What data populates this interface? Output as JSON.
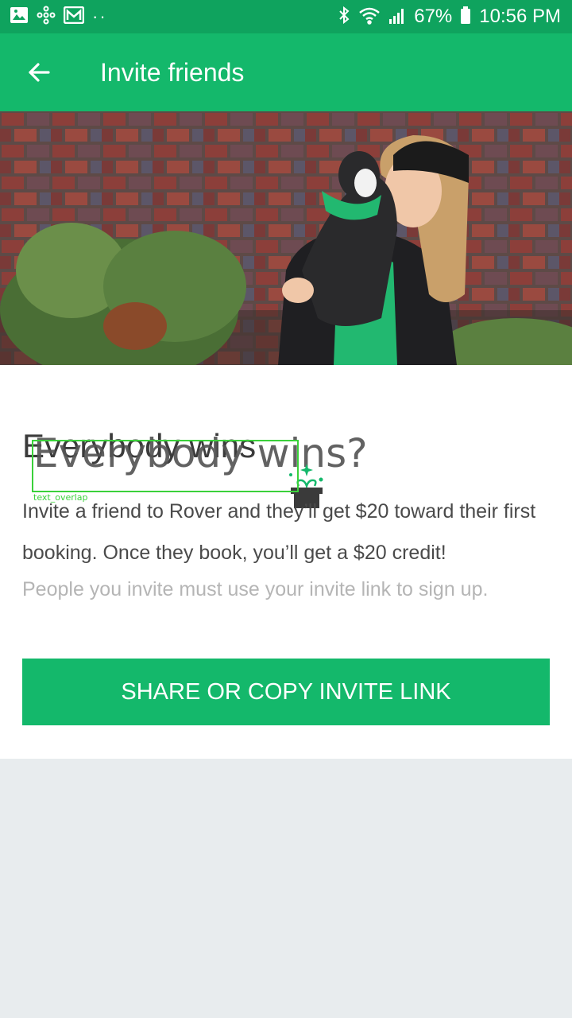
{
  "status_bar": {
    "battery": "67%",
    "time": "10:56 PM",
    "dots": "··",
    "icons": [
      "gallery-icon",
      "pinwheel-icon",
      "mail-icon",
      "bluetooth-icon",
      "wifi-icon",
      "signal-icon",
      "battery-icon"
    ]
  },
  "app_bar": {
    "title": "Invite friends",
    "back_icon": "arrow-left-icon"
  },
  "content": {
    "headline_back": "Everybody wins",
    "headline_front": "Everybody wins?",
    "gift_icon": "gift-icon",
    "overlap_label": "text_overlap",
    "body": "Invite a friend to Rover and they’ll get $20 toward their first booking. Once they book, you’ll get a $20 credit!",
    "note": "People you invite must use your invite link to sign up.",
    "cta_label": "SHARE OR COPY INVITE LINK"
  },
  "colors": {
    "status_bar": "#0fa35e",
    "app_bar": "#14b86b",
    "cta": "#14b86b",
    "background": "#e8ecee"
  }
}
